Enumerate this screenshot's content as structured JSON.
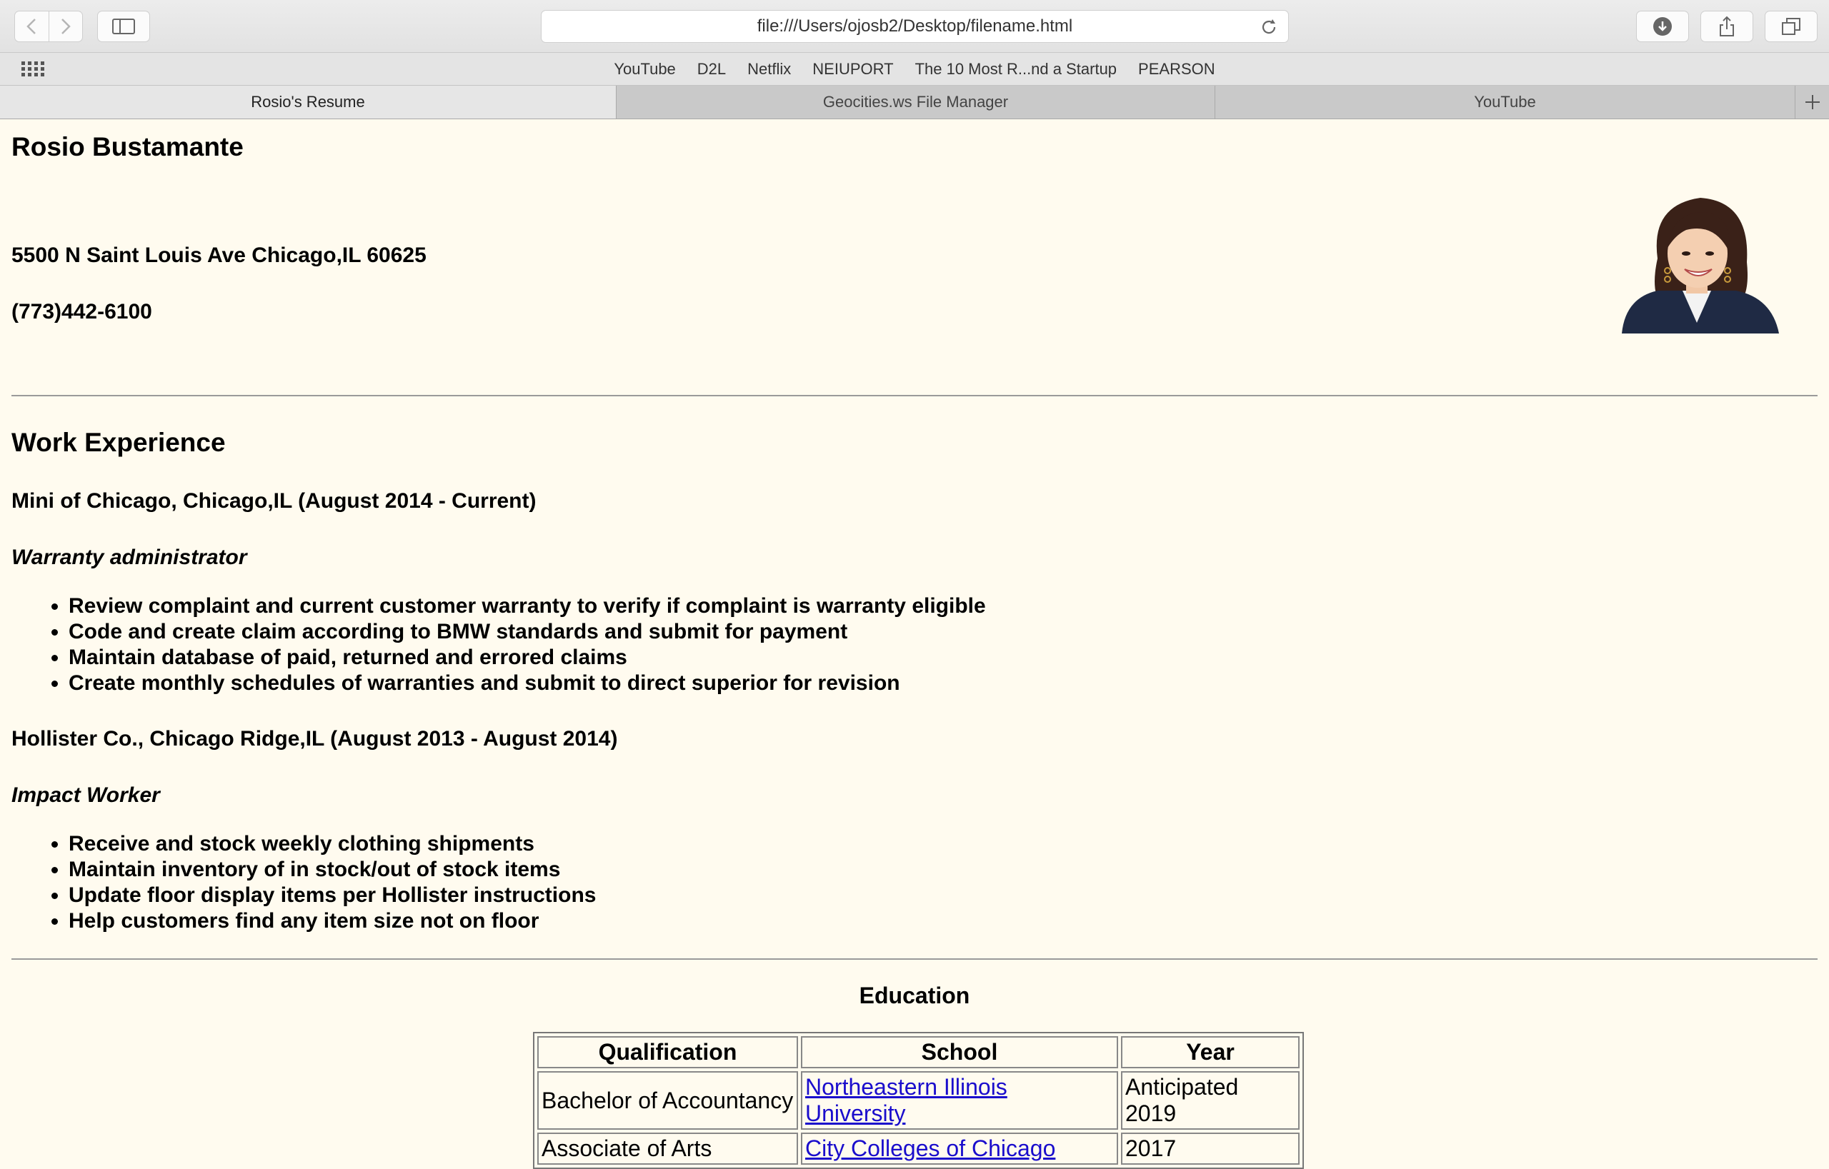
{
  "browser": {
    "url": "file:///Users/ojosb2/Desktop/filename.html",
    "bookmarks": [
      "YouTube",
      "D2L",
      "Netflix",
      "NEIUPORT",
      "The 10 Most R...nd a Startup",
      "PEARSON"
    ],
    "tabs": [
      {
        "label": "Rosio's Resume",
        "active": true
      },
      {
        "label": "Geocities.ws File Manager",
        "active": false
      },
      {
        "label": "YouTube",
        "active": false
      }
    ]
  },
  "resume": {
    "name": "Rosio Bustamante",
    "address": "5500 N Saint Louis Ave Chicago,IL 60625",
    "phone": "(773)442-6100",
    "work_heading": "Work Experience",
    "jobs": [
      {
        "employer": "Mini of Chicago, Chicago,IL  (August 2014 - Current)",
        "title": "Warranty administrator",
        "duties": [
          "Review complaint and current customer warranty to verify if complaint is warranty eligible",
          "Code and create claim according to BMW standards and submit for payment",
          "Maintain database of paid, returned and errored claims",
          "Create monthly schedules of warranties and submit to direct superior for revision"
        ]
      },
      {
        "employer": "Hollister Co., Chicago Ridge,IL  (August 2013 - August 2014)",
        "title": "Impact Worker",
        "duties": [
          "Receive and stock weekly clothing shipments",
          "Maintain inventory of in stock/out of stock items",
          "Update floor display items per Hollister instructions",
          "Help customers find any item size not on floor"
        ]
      }
    ],
    "education": {
      "heading": "Education",
      "headers": [
        "Qualification",
        "School",
        "Year"
      ],
      "rows": [
        [
          "Bachelor of Accountancy",
          "Northeastern Illinois University",
          "Anticipated 2019"
        ],
        [
          "Associate of Arts",
          "City Colleges of Chicago",
          "2017"
        ]
      ]
    }
  },
  "icons": {
    "back": "chevron-left-icon",
    "forward": "chevron-right-icon",
    "sidebar": "sidebar-icon",
    "reload": "reload-icon",
    "download": "download-icon",
    "share": "share-icon",
    "tabs": "tabs-overview-icon",
    "apps": "grid-icon",
    "new_tab": "plus-icon"
  },
  "colors": {
    "page_background": "#fffbef",
    "link": "#1a0dcc"
  }
}
